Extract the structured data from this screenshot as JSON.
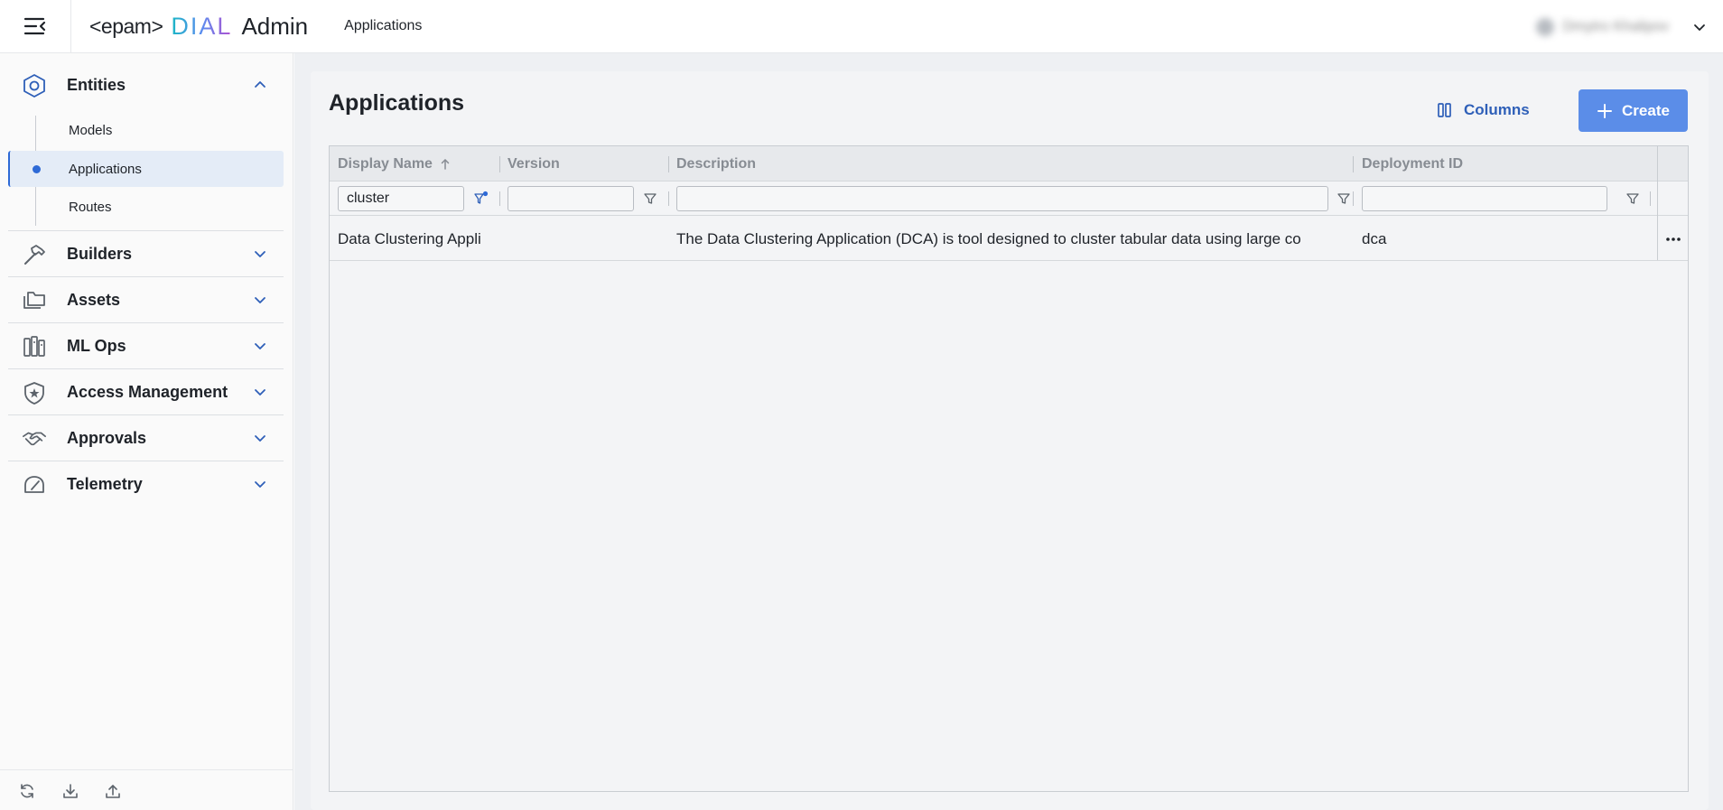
{
  "header": {
    "logo_epam": "<epam>",
    "logo_dial": "DIAL",
    "logo_admin": "Admin",
    "breadcrumb": "Applications",
    "user_name": "Dmytro Khalipov"
  },
  "sidebar": {
    "sections": [
      {
        "label": "Entities",
        "icon": "hexagon-icon",
        "expanded": true
      },
      {
        "label": "Builders",
        "icon": "hammer-icon",
        "expanded": false
      },
      {
        "label": "Assets",
        "icon": "folders-icon",
        "expanded": false
      },
      {
        "label": "ML Ops",
        "icon": "ml-ops-icon",
        "expanded": false
      },
      {
        "label": "Access Management",
        "icon": "shield-star-icon",
        "expanded": false
      },
      {
        "label": "Approvals",
        "icon": "handshake-icon",
        "expanded": false
      },
      {
        "label": "Telemetry",
        "icon": "gauge-icon",
        "expanded": false
      }
    ],
    "entities_items": [
      {
        "label": "Models",
        "active": false
      },
      {
        "label": "Applications",
        "active": true
      },
      {
        "label": "Routes",
        "active": false
      }
    ],
    "footer_icons": [
      "refresh-icon",
      "download-icon",
      "upload-icon"
    ]
  },
  "main": {
    "title": "Applications",
    "columns_label": "Columns",
    "create_label": "Create",
    "columns": [
      {
        "label": "Display Name",
        "sort": "asc"
      },
      {
        "label": "Version"
      },
      {
        "label": "Description"
      },
      {
        "label": "Deployment ID"
      }
    ],
    "filters": {
      "display_name": "cluster",
      "version": "",
      "description": "",
      "deployment_id": ""
    },
    "rows": [
      {
        "display_name": "Data Clustering Appli",
        "version": "",
        "description": "The Data Clustering Application (DCA) is tool designed to cluster tabular data using large co",
        "deployment_id": "dca"
      }
    ]
  },
  "colors": {
    "accent": "#2e6ad6",
    "create_button": "#5b8de8",
    "columns_text": "#2e5fb8"
  }
}
